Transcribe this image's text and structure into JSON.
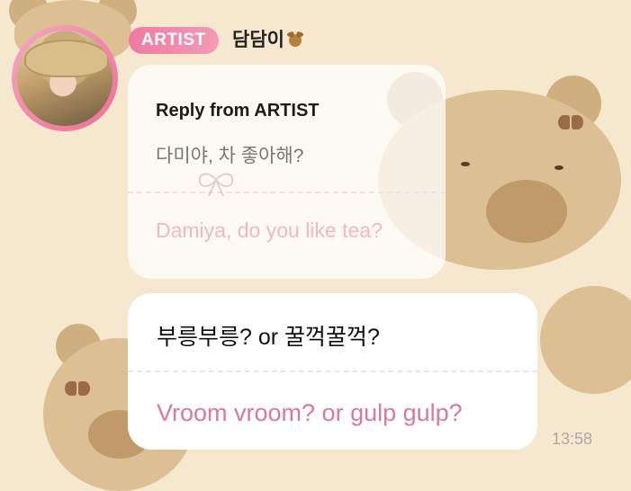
{
  "header": {
    "badge_label": "ARTIST",
    "sender_name": "담담이"
  },
  "reply": {
    "title": "Reply from ARTIST",
    "original_korean": "다미야, 차 좋아해?",
    "original_english": "Damiya, do you like tea?"
  },
  "message": {
    "korean": "부릉부릉? or 꿀꺽꿀꺽?",
    "english": "Vroom vroom? or gulp gulp?"
  },
  "timestamp": "13:58",
  "colors": {
    "background": "#f6e7cf",
    "badge": "#ef7aa1",
    "translation_text": "#d9799d",
    "faded_translation_text": "#f3b6c9"
  },
  "icons": [
    "teddy-bear-emoji",
    "bear-wallpaper",
    "bow-icon"
  ]
}
